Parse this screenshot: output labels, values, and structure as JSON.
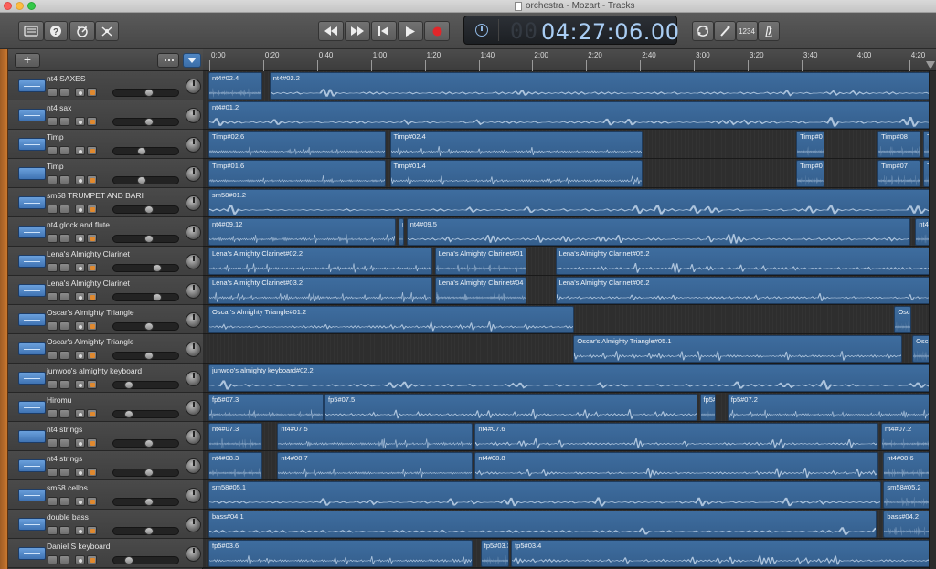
{
  "window": {
    "title": "orchestra - Mozart - Tracks"
  },
  "toolbar": {
    "left_buttons": [
      "library-icon",
      "help-icon",
      "smart-controls-icon",
      "editors-icon"
    ],
    "transport": [
      "rewind-icon",
      "fast-forward-icon",
      "go-to-beginning-icon",
      "play-icon",
      "record-icon"
    ],
    "right_buttons": [
      "cycle-icon",
      "tuner-icon",
      "count-in-icon",
      "metronome-icon"
    ],
    "count_in_label": "1234",
    "lcd": {
      "time": "04:27:06.00",
      "dim_digits": "00",
      "mode_icon": "clock-icon"
    }
  },
  "header_panel": {
    "add_label": "+"
  },
  "ruler": {
    "ticks": [
      "0:00",
      "0:20",
      "0:40",
      "1:00",
      "1:20",
      "1:40",
      "2:00",
      "2:20",
      "2:40",
      "3:00",
      "3:20",
      "3:40",
      "4:00",
      "4:20"
    ]
  },
  "colors": {
    "region": "#3e6d9f",
    "lcd_text": "#a9cdf3",
    "accent_orange": "#c9782f"
  },
  "tracks": [
    {
      "name": "nt4 SAXES",
      "volume": 0.55,
      "regions": [
        {
          "name": "nt4#02.4",
          "start": 0.0,
          "end": 0.075
        },
        {
          "name": "nt4#02.2",
          "start": 0.084,
          "end": 1.0
        }
      ]
    },
    {
      "name": "nt4 sax",
      "volume": 0.55,
      "regions": [
        {
          "name": "nt4#01.2",
          "start": 0.0,
          "end": 1.0
        }
      ]
    },
    {
      "name": "Timp",
      "volume": 0.42,
      "regions": [
        {
          "name": "Timp#02.6",
          "start": 0.0,
          "end": 0.245
        },
        {
          "name": "Timp#02.4",
          "start": 0.25,
          "end": 0.6
        },
        {
          "name": "Timp#0",
          "start": 0.81,
          "end": 0.85
        },
        {
          "name": "Timp#08",
          "start": 0.922,
          "end": 0.983
        },
        {
          "name": "Tim",
          "start": 0.985,
          "end": 1.0
        }
      ]
    },
    {
      "name": "Timp",
      "volume": 0.42,
      "regions": [
        {
          "name": "Timp#01.6",
          "start": 0.0,
          "end": 0.245
        },
        {
          "name": "Timp#01.4",
          "start": 0.25,
          "end": 0.6
        },
        {
          "name": "Timp#0",
          "start": 0.81,
          "end": 0.85
        },
        {
          "name": "Timp#07",
          "start": 0.922,
          "end": 0.983
        },
        {
          "name": "Tim",
          "start": 0.985,
          "end": 1.0
        }
      ]
    },
    {
      "name": "sm58 TRUMPET AND BARI",
      "volume": 0.55,
      "regions": [
        {
          "name": "sm58#01.2",
          "start": 0.0,
          "end": 1.0
        }
      ]
    },
    {
      "name": "nt4 glock and flute",
      "volume": 0.55,
      "regions": [
        {
          "name": "nt4#09.12",
          "start": 0.0,
          "end": 0.259
        },
        {
          "name": "n",
          "start": 0.262,
          "end": 0.27
        },
        {
          "name": "nt4#09.5",
          "start": 0.273,
          "end": 0.968
        },
        {
          "name": "nt4",
          "start": 0.974,
          "end": 1.0
        }
      ]
    },
    {
      "name": "Lena's Almighty Clarinet",
      "volume": 0.7,
      "regions": [
        {
          "name": "Lena's Almighty Clarinet#02.2",
          "start": 0.0,
          "end": 0.31
        },
        {
          "name": "Lena's Almighty Clarinet#01",
          "start": 0.312,
          "end": 0.44
        },
        {
          "name": "Lena's Almighty Clarinet#05.2",
          "start": 0.478,
          "end": 1.0
        }
      ]
    },
    {
      "name": "Lena's Almighty Clarinet",
      "volume": 0.7,
      "regions": [
        {
          "name": "Lena's Almighty Clarinet#03.2",
          "start": 0.0,
          "end": 0.31
        },
        {
          "name": "Lena's Almighty Clarinet#04",
          "start": 0.312,
          "end": 0.44
        },
        {
          "name": "Lena's Almighty Clarinet#06.2",
          "start": 0.478,
          "end": 1.0
        }
      ]
    },
    {
      "name": "Oscar's Almighty Triangle",
      "volume": 0.55,
      "regions": [
        {
          "name": "Oscar's Almighty Triangle#01.2",
          "start": 0.0,
          "end": 0.505
        },
        {
          "name": "Osc",
          "start": 0.945,
          "end": 0.97
        }
      ]
    },
    {
      "name": "Oscar's Almighty Triangle",
      "volume": 0.55,
      "regions": [
        {
          "name": "Oscar's Almighty Triangle#05.1",
          "start": 0.503,
          "end": 0.957
        },
        {
          "name": "Osc",
          "start": 0.97,
          "end": 1.0
        }
      ]
    },
    {
      "name": "junwoo's almighty keyboard",
      "volume": 0.2,
      "regions": [
        {
          "name": "junwoo's almighty keyboard#02.2",
          "start": 0.0,
          "end": 1.0
        }
      ]
    },
    {
      "name": "Hiromu",
      "volume": 0.2,
      "regions": [
        {
          "name": "fp5#07.3",
          "start": 0.0,
          "end": 0.16
        },
        {
          "name": "fp5#07.5",
          "start": 0.16,
          "end": 0.675
        },
        {
          "name": "fp5#",
          "start": 0.677,
          "end": 0.7
        },
        {
          "name": "fp5#07.2",
          "start": 0.715,
          "end": 1.0
        }
      ]
    },
    {
      "name": "nt4 strings",
      "volume": 0.55,
      "regions": [
        {
          "name": "nt4#07.3",
          "start": 0.0,
          "end": 0.075
        },
        {
          "name": "nt4#07.5",
          "start": 0.095,
          "end": 0.365
        },
        {
          "name": "nt4#07.6",
          "start": 0.367,
          "end": 0.925
        },
        {
          "name": "nt4#07.2",
          "start": 0.927,
          "end": 1.0
        }
      ]
    },
    {
      "name": "nt4 strings",
      "volume": 0.55,
      "regions": [
        {
          "name": "nt4#08.3",
          "start": 0.0,
          "end": 0.075
        },
        {
          "name": "nt4#08.7",
          "start": 0.095,
          "end": 0.365
        },
        {
          "name": "nt4#08.8",
          "start": 0.367,
          "end": 0.925
        },
        {
          "name": "nt4#08.6",
          "start": 0.93,
          "end": 1.0
        }
      ]
    },
    {
      "name": "sm58 cellos",
      "volume": 0.55,
      "regions": [
        {
          "name": "sm58#05.1",
          "start": 0.0,
          "end": 0.928
        },
        {
          "name": "sm58#05.2",
          "start": 0.93,
          "end": 1.0
        }
      ]
    },
    {
      "name": "double bass",
      "volume": 0.55,
      "regions": [
        {
          "name": "bass#04.1",
          "start": 0.0,
          "end": 0.922
        },
        {
          "name": "bass#04.2",
          "start": 0.93,
          "end": 1.0
        }
      ]
    },
    {
      "name": "Daniel S keyboard",
      "volume": 0.2,
      "regions": [
        {
          "name": "fp5#03.6",
          "start": 0.0,
          "end": 0.365
        },
        {
          "name": "fp5#03.3",
          "start": 0.375,
          "end": 0.415
        },
        {
          "name": "fp5#03.4",
          "start": 0.417,
          "end": 1.0
        }
      ]
    }
  ]
}
